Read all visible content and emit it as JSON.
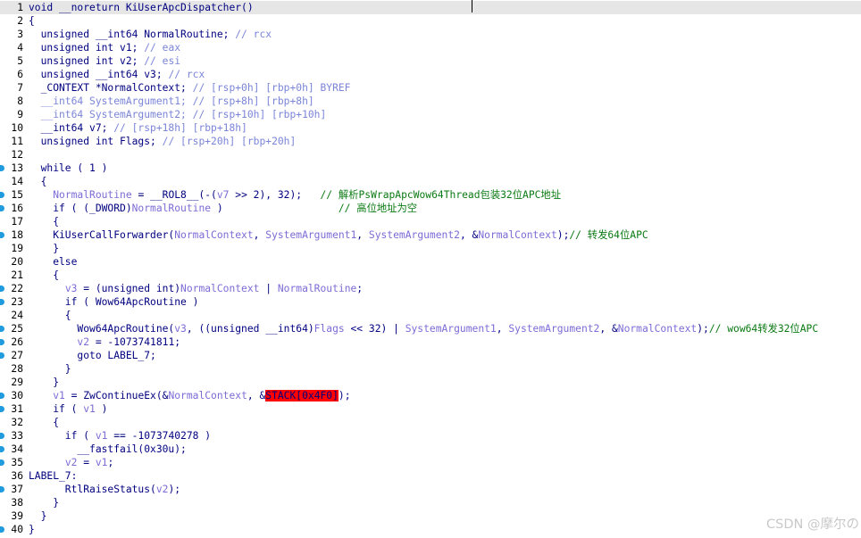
{
  "editor": {
    "lines": [
      {
        "n": "1",
        "current": true,
        "marker": false,
        "segs": [
          [
            "void __noreturn KiUserApcDispatcher()",
            "id"
          ]
        ]
      },
      {
        "n": "2",
        "marker": false,
        "segs": [
          [
            "{",
            "pun"
          ]
        ]
      },
      {
        "n": "3",
        "marker": false,
        "segs": [
          [
            "  unsigned __int64 NormalRoutine; ",
            "id"
          ],
          [
            "// rcx",
            "com"
          ]
        ]
      },
      {
        "n": "4",
        "marker": false,
        "segs": [
          [
            "  unsigned int v1; ",
            "id"
          ],
          [
            "// eax",
            "com"
          ]
        ]
      },
      {
        "n": "5",
        "marker": false,
        "segs": [
          [
            "  unsigned int v2; ",
            "id"
          ],
          [
            "// esi",
            "com"
          ]
        ]
      },
      {
        "n": "6",
        "marker": false,
        "segs": [
          [
            "  unsigned __int64 v3; ",
            "id"
          ],
          [
            "// rcx",
            "com"
          ]
        ]
      },
      {
        "n": "7",
        "marker": false,
        "segs": [
          [
            "  _CONTEXT *NormalContext; ",
            "id"
          ],
          [
            "// [rsp+0h] [rbp+0h] BYREF",
            "com"
          ]
        ]
      },
      {
        "n": "8",
        "marker": false,
        "segs": [
          [
            "  __int64 SystemArgument1; ",
            "com"
          ],
          [
            "// [rsp+8h] [rbp+8h]",
            "com"
          ]
        ]
      },
      {
        "n": "9",
        "marker": false,
        "segs": [
          [
            "  __int64 SystemArgument2; ",
            "com"
          ],
          [
            "// [rsp+10h] [rbp+10h]",
            "com"
          ]
        ]
      },
      {
        "n": "10",
        "marker": false,
        "segs": [
          [
            "  __int64 v7; ",
            "id"
          ],
          [
            "// [rsp+18h] [rbp+18h]",
            "com"
          ]
        ]
      },
      {
        "n": "11",
        "marker": false,
        "segs": [
          [
            "  unsigned int Flags; ",
            "id"
          ],
          [
            "// [rsp+20h] [rbp+20h]",
            "com"
          ]
        ]
      },
      {
        "n": "12",
        "marker": false,
        "segs": [
          [
            "",
            "id"
          ]
        ]
      },
      {
        "n": "13",
        "marker": true,
        "segs": [
          [
            "  while ( 1 )",
            "id"
          ]
        ]
      },
      {
        "n": "14",
        "marker": false,
        "segs": [
          [
            "  {",
            "pun"
          ]
        ]
      },
      {
        "n": "15",
        "marker": true,
        "segs": [
          [
            "    ",
            "id"
          ],
          [
            "NormalRoutine",
            "var"
          ],
          [
            " = __ROL8__(-(",
            "id"
          ],
          [
            "v7",
            "var"
          ],
          [
            " >> 2), 32);   ",
            "id"
          ],
          [
            "// 解析PsWrapApcWow64Thread包装32位APC地址",
            "cmt"
          ]
        ]
      },
      {
        "n": "16",
        "marker": true,
        "segs": [
          [
            "    if ( (_DWORD)",
            "id"
          ],
          [
            "NormalRoutine",
            "var"
          ],
          [
            " )                   ",
            "id"
          ],
          [
            "// 高位地址为空",
            "cmt"
          ]
        ]
      },
      {
        "n": "17",
        "marker": false,
        "segs": [
          [
            "    {",
            "pun"
          ]
        ]
      },
      {
        "n": "18",
        "marker": true,
        "segs": [
          [
            "    KiUserCallForwarder(",
            "id"
          ],
          [
            "NormalContext",
            "var"
          ],
          [
            ", ",
            "id"
          ],
          [
            "SystemArgument1",
            "var"
          ],
          [
            ", ",
            "id"
          ],
          [
            "SystemArgument2",
            "var"
          ],
          [
            ", &",
            "id"
          ],
          [
            "NormalContext",
            "var"
          ],
          [
            ");",
            "id"
          ],
          [
            "// 转发64位APC",
            "cmt"
          ]
        ]
      },
      {
        "n": "19",
        "marker": false,
        "segs": [
          [
            "    }",
            "pun"
          ]
        ]
      },
      {
        "n": "20",
        "marker": false,
        "segs": [
          [
            "    else",
            "id"
          ]
        ]
      },
      {
        "n": "21",
        "marker": false,
        "segs": [
          [
            "    {",
            "pun"
          ]
        ]
      },
      {
        "n": "22",
        "marker": true,
        "segs": [
          [
            "      ",
            "id"
          ],
          [
            "v3",
            "var"
          ],
          [
            " = (unsigned int)",
            "id"
          ],
          [
            "NormalContext",
            "var"
          ],
          [
            " | ",
            "id"
          ],
          [
            "NormalRoutine",
            "var"
          ],
          [
            ";",
            "id"
          ]
        ]
      },
      {
        "n": "23",
        "marker": true,
        "segs": [
          [
            "      if ( ",
            "id"
          ],
          [
            "Wow64ApcRoutine",
            "id"
          ],
          [
            " )",
            "id"
          ]
        ]
      },
      {
        "n": "24",
        "marker": false,
        "segs": [
          [
            "      {",
            "pun"
          ]
        ]
      },
      {
        "n": "25",
        "marker": true,
        "segs": [
          [
            "        Wow64ApcRoutine(",
            "id"
          ],
          [
            "v3",
            "var"
          ],
          [
            ", ((unsigned __int64)",
            "id"
          ],
          [
            "Flags",
            "var"
          ],
          [
            " << 32) | ",
            "id"
          ],
          [
            "SystemArgument1",
            "var"
          ],
          [
            ", ",
            "id"
          ],
          [
            "SystemArgument2",
            "var"
          ],
          [
            ", &",
            "id"
          ],
          [
            "NormalContext",
            "var"
          ],
          [
            ");",
            "id"
          ],
          [
            "// wow64转发32位APC",
            "cmt"
          ]
        ]
      },
      {
        "n": "26",
        "marker": true,
        "segs": [
          [
            "        ",
            "id"
          ],
          [
            "v2",
            "var"
          ],
          [
            " = -1073741811;",
            "id"
          ]
        ]
      },
      {
        "n": "27",
        "marker": true,
        "segs": [
          [
            "        goto LABEL_7;",
            "id"
          ]
        ]
      },
      {
        "n": "28",
        "marker": false,
        "segs": [
          [
            "      }",
            "pun"
          ]
        ]
      },
      {
        "n": "29",
        "marker": false,
        "segs": [
          [
            "    }",
            "pun"
          ]
        ]
      },
      {
        "n": "30",
        "marker": true,
        "segs": [
          [
            "    ",
            "id"
          ],
          [
            "v1",
            "var"
          ],
          [
            " = ZwContinueEx(&",
            "id"
          ],
          [
            "NormalContext",
            "var"
          ],
          [
            ", &",
            "id"
          ],
          [
            "STACK[0x4F0]",
            "stack"
          ],
          [
            ");",
            "id"
          ]
        ]
      },
      {
        "n": "31",
        "marker": true,
        "segs": [
          [
            "    if ( ",
            "id"
          ],
          [
            "v1",
            "var"
          ],
          [
            " )",
            "id"
          ]
        ]
      },
      {
        "n": "32",
        "marker": false,
        "segs": [
          [
            "    {",
            "pun"
          ]
        ]
      },
      {
        "n": "33",
        "marker": true,
        "segs": [
          [
            "      if ( ",
            "id"
          ],
          [
            "v1",
            "var"
          ],
          [
            " == -1073740278 )",
            "id"
          ]
        ]
      },
      {
        "n": "34",
        "marker": true,
        "segs": [
          [
            "        __fastfail(0x30u);",
            "id"
          ]
        ]
      },
      {
        "n": "35",
        "marker": true,
        "segs": [
          [
            "      ",
            "id"
          ],
          [
            "v2",
            "var"
          ],
          [
            " = ",
            "id"
          ],
          [
            "v1",
            "var"
          ],
          [
            ";",
            "id"
          ]
        ]
      },
      {
        "n": "36",
        "marker": false,
        "segs": [
          [
            "LABEL_7:",
            "id"
          ]
        ]
      },
      {
        "n": "37",
        "marker": true,
        "segs": [
          [
            "      RtlRaiseStatus(",
            "id"
          ],
          [
            "v2",
            "var"
          ],
          [
            ");",
            "id"
          ]
        ]
      },
      {
        "n": "38",
        "marker": false,
        "segs": [
          [
            "    }",
            "pun"
          ]
        ]
      },
      {
        "n": "39",
        "marker": false,
        "segs": [
          [
            "  }",
            "pun"
          ]
        ]
      },
      {
        "n": "40",
        "marker": true,
        "segs": [
          [
            "}",
            "pun"
          ]
        ]
      }
    ]
  },
  "watermark": "CSDN @摩尔の",
  "colors": {
    "keyword": "#000080",
    "variable": "#7d6bd6",
    "comment_gray": "#7b85d8",
    "comment_green": "#0a7a12",
    "highlight_red": "#ff0000",
    "current_line": "#e6e6e6",
    "marker": "#1f9bde"
  }
}
